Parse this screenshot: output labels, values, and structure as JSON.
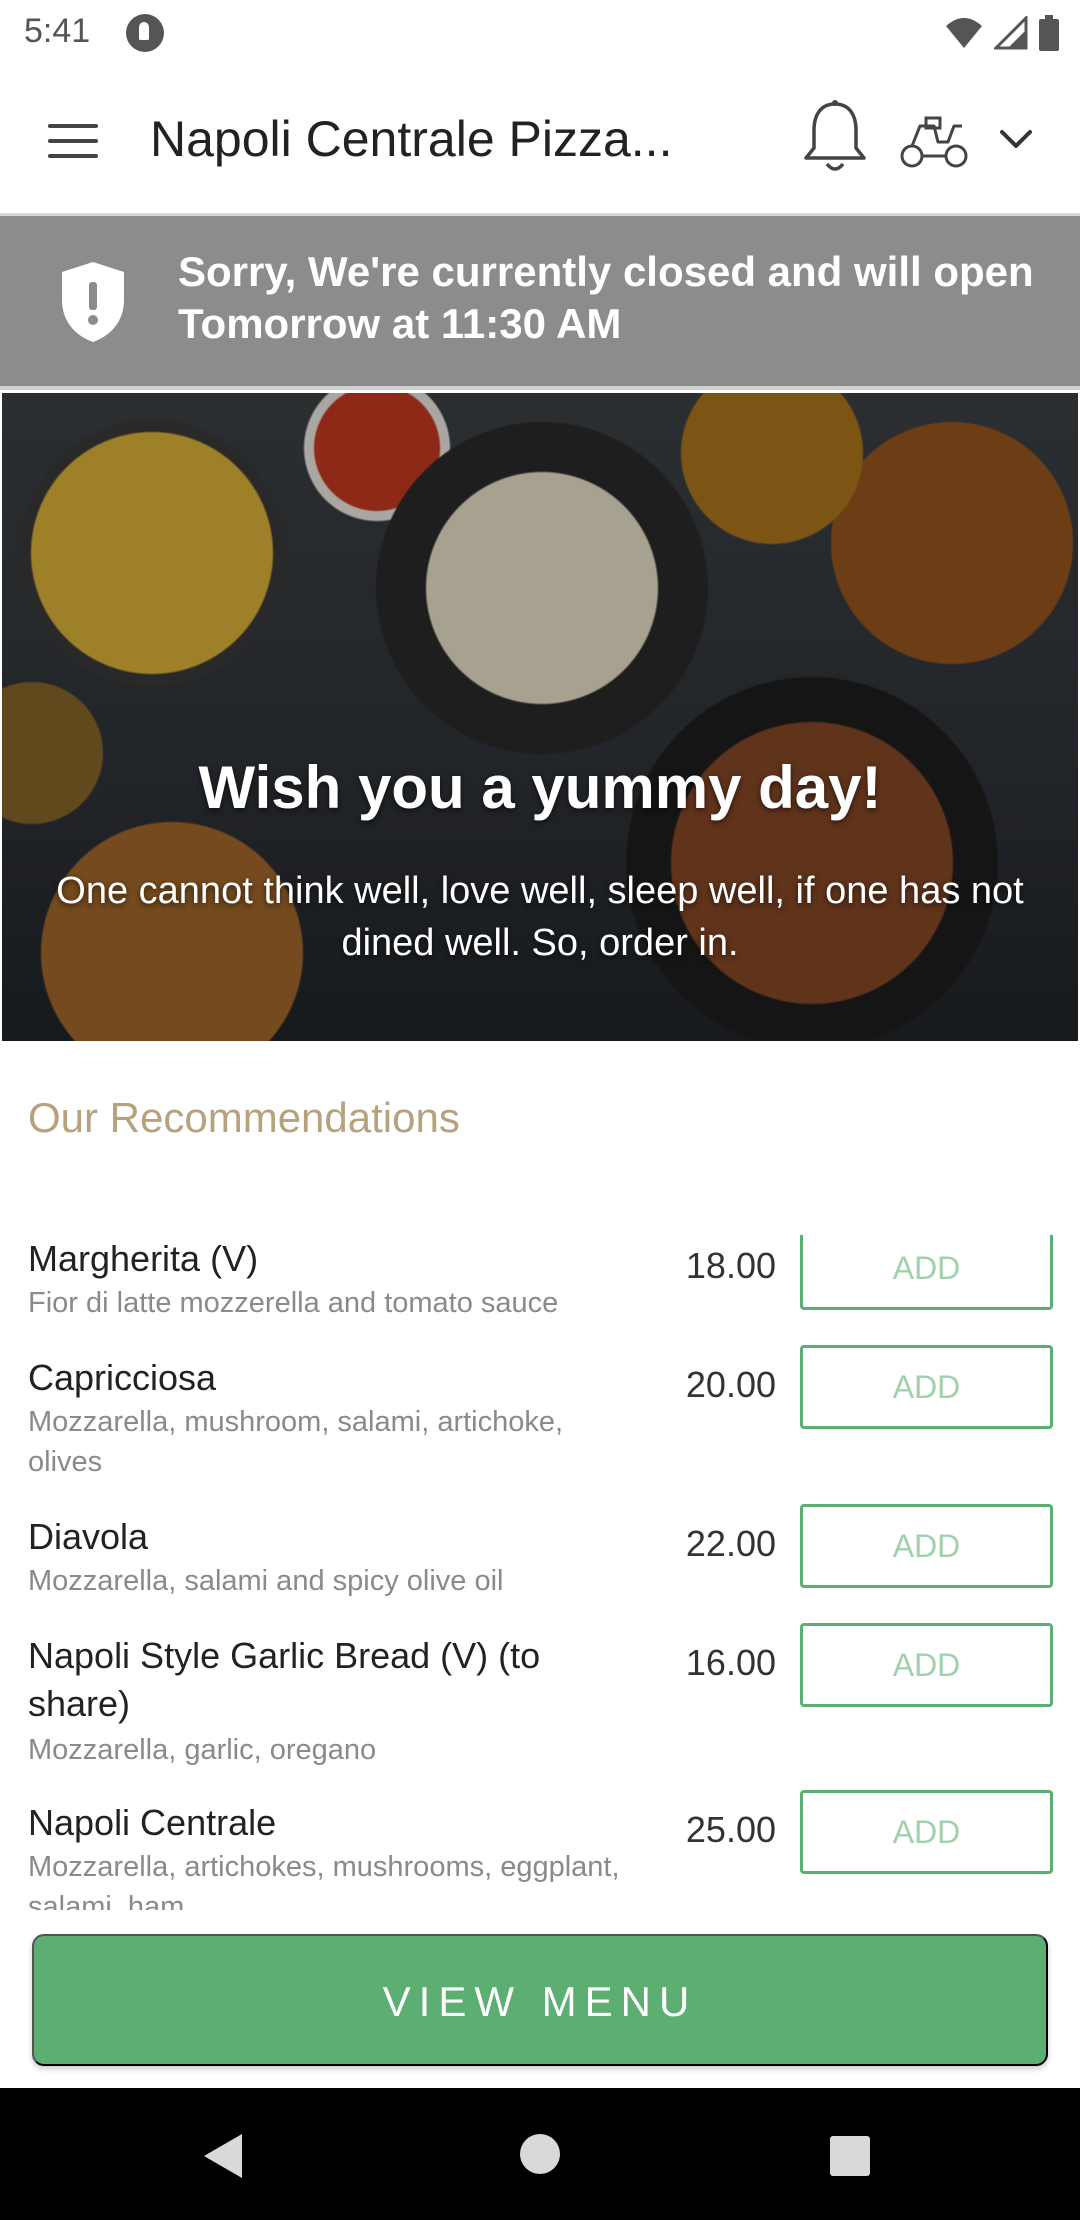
{
  "status_bar": {
    "time": "5:41"
  },
  "app_bar": {
    "title": "Napoli Centrale Pizza..."
  },
  "banner": {
    "text": "Sorry, We're currently closed and will open Tomorrow at 11:30 AM"
  },
  "hero": {
    "headline": "Wish you a yummy day!",
    "subtext": "One cannot think well, love well, sleep well, if one has not dined well. So, order in."
  },
  "recommendations": {
    "title": "Our Recommendations",
    "add_label": "ADD",
    "items": [
      {
        "name": "Margherita (V)",
        "description": "Fior di latte mozzerella and tomato sauce",
        "price": "18.00"
      },
      {
        "name": "Capricciosa",
        "description": "Mozzarella, mushroom, salami, artichoke, olives",
        "price": "20.00"
      },
      {
        "name": "Diavola",
        "description": "Mozzarella, salami and spicy olive oil",
        "price": "22.00"
      },
      {
        "name": "Napoli Style Garlic Bread (V) (to share)",
        "description": "Mozzarella, garlic, oregano",
        "price": "16.00"
      },
      {
        "name": "Napoli Centrale",
        "description": "Mozzarella, artichokes, mushrooms, eggplant, salami, ham",
        "price": "25.00"
      }
    ]
  },
  "view_menu_label": "VIEW MENU",
  "colors": {
    "accent_green": "#5cae72",
    "banner_grey": "#8c8c8c",
    "section_title": "#b7a27e"
  }
}
